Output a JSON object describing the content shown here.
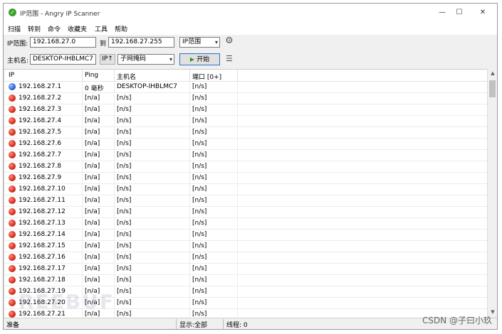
{
  "titlebar": {
    "title": "IP范围 - Angry IP Scanner",
    "minimize": "—",
    "maximize": "☐",
    "close": "✕"
  },
  "menu": [
    "扫描",
    "转到",
    "命令",
    "收藏夹",
    "工具",
    "帮助"
  ],
  "toolbar": {
    "ip_range_label": "IP范围:",
    "ip_start": "192.168.27.0",
    "to_label": "到",
    "ip_end": "192.168.27.255",
    "range_type": "IP范围",
    "hostname_label": "主机名:",
    "hostname": "DESKTOP-IHBLMC7",
    "ip_button": "IP↑",
    "netmask": "子网掩码",
    "start_label": "开始"
  },
  "columns": [
    "IP",
    "Ping",
    "主机名",
    "端口 [0+]"
  ],
  "rows": [
    {
      "ip": "192.168.27.1",
      "ping": "0 毫秒",
      "host": "DESKTOP-IHBLMC7",
      "ports": "[n/s]",
      "alive": true
    },
    {
      "ip": "192.168.27.2",
      "ping": "[n/a]",
      "host": "[n/s]",
      "ports": "[n/s]",
      "alive": false
    },
    {
      "ip": "192.168.27.3",
      "ping": "[n/a]",
      "host": "[n/s]",
      "ports": "[n/s]",
      "alive": false
    },
    {
      "ip": "192.168.27.4",
      "ping": "[n/a]",
      "host": "[n/s]",
      "ports": "[n/s]",
      "alive": false
    },
    {
      "ip": "192.168.27.5",
      "ping": "[n/a]",
      "host": "[n/s]",
      "ports": "[n/s]",
      "alive": false
    },
    {
      "ip": "192.168.27.6",
      "ping": "[n/a]",
      "host": "[n/s]",
      "ports": "[n/s]",
      "alive": false
    },
    {
      "ip": "192.168.27.7",
      "ping": "[n/a]",
      "host": "[n/s]",
      "ports": "[n/s]",
      "alive": false
    },
    {
      "ip": "192.168.27.8",
      "ping": "[n/a]",
      "host": "[n/s]",
      "ports": "[n/s]",
      "alive": false
    },
    {
      "ip": "192.168.27.9",
      "ping": "[n/a]",
      "host": "[n/s]",
      "ports": "[n/s]",
      "alive": false
    },
    {
      "ip": "192.168.27.10",
      "ping": "[n/a]",
      "host": "[n/s]",
      "ports": "[n/s]",
      "alive": false
    },
    {
      "ip": "192.168.27.11",
      "ping": "[n/a]",
      "host": "[n/s]",
      "ports": "[n/s]",
      "alive": false
    },
    {
      "ip": "192.168.27.12",
      "ping": "[n/a]",
      "host": "[n/s]",
      "ports": "[n/s]",
      "alive": false
    },
    {
      "ip": "192.168.27.13",
      "ping": "[n/a]",
      "host": "[n/s]",
      "ports": "[n/s]",
      "alive": false
    },
    {
      "ip": "192.168.27.14",
      "ping": "[n/a]",
      "host": "[n/s]",
      "ports": "[n/s]",
      "alive": false
    },
    {
      "ip": "192.168.27.15",
      "ping": "[n/a]",
      "host": "[n/s]",
      "ports": "[n/s]",
      "alive": false
    },
    {
      "ip": "192.168.27.16",
      "ping": "[n/a]",
      "host": "[n/s]",
      "ports": "[n/s]",
      "alive": false
    },
    {
      "ip": "192.168.27.17",
      "ping": "[n/a]",
      "host": "[n/s]",
      "ports": "[n/s]",
      "alive": false
    },
    {
      "ip": "192.168.27.18",
      "ping": "[n/a]",
      "host": "[n/s]",
      "ports": "[n/s]",
      "alive": false
    },
    {
      "ip": "192.168.27.19",
      "ping": "[n/a]",
      "host": "[n/s]",
      "ports": "[n/s]",
      "alive": false
    },
    {
      "ip": "192.168.27.20",
      "ping": "[n/a]",
      "host": "[n/s]",
      "ports": "[n/s]",
      "alive": false
    },
    {
      "ip": "192.168.27.21",
      "ping": "[n/a]",
      "host": "[n/s]",
      "ports": "[n/s]",
      "alive": false
    }
  ],
  "status": {
    "ready": "准备",
    "display": "显示:全部",
    "threads": "线程: 0"
  },
  "watermark": "CSDN @子曰小玖",
  "colors": {
    "alive": "#2d5fd6",
    "dead": "#d62d1d",
    "start_border": "#2f72c4"
  }
}
